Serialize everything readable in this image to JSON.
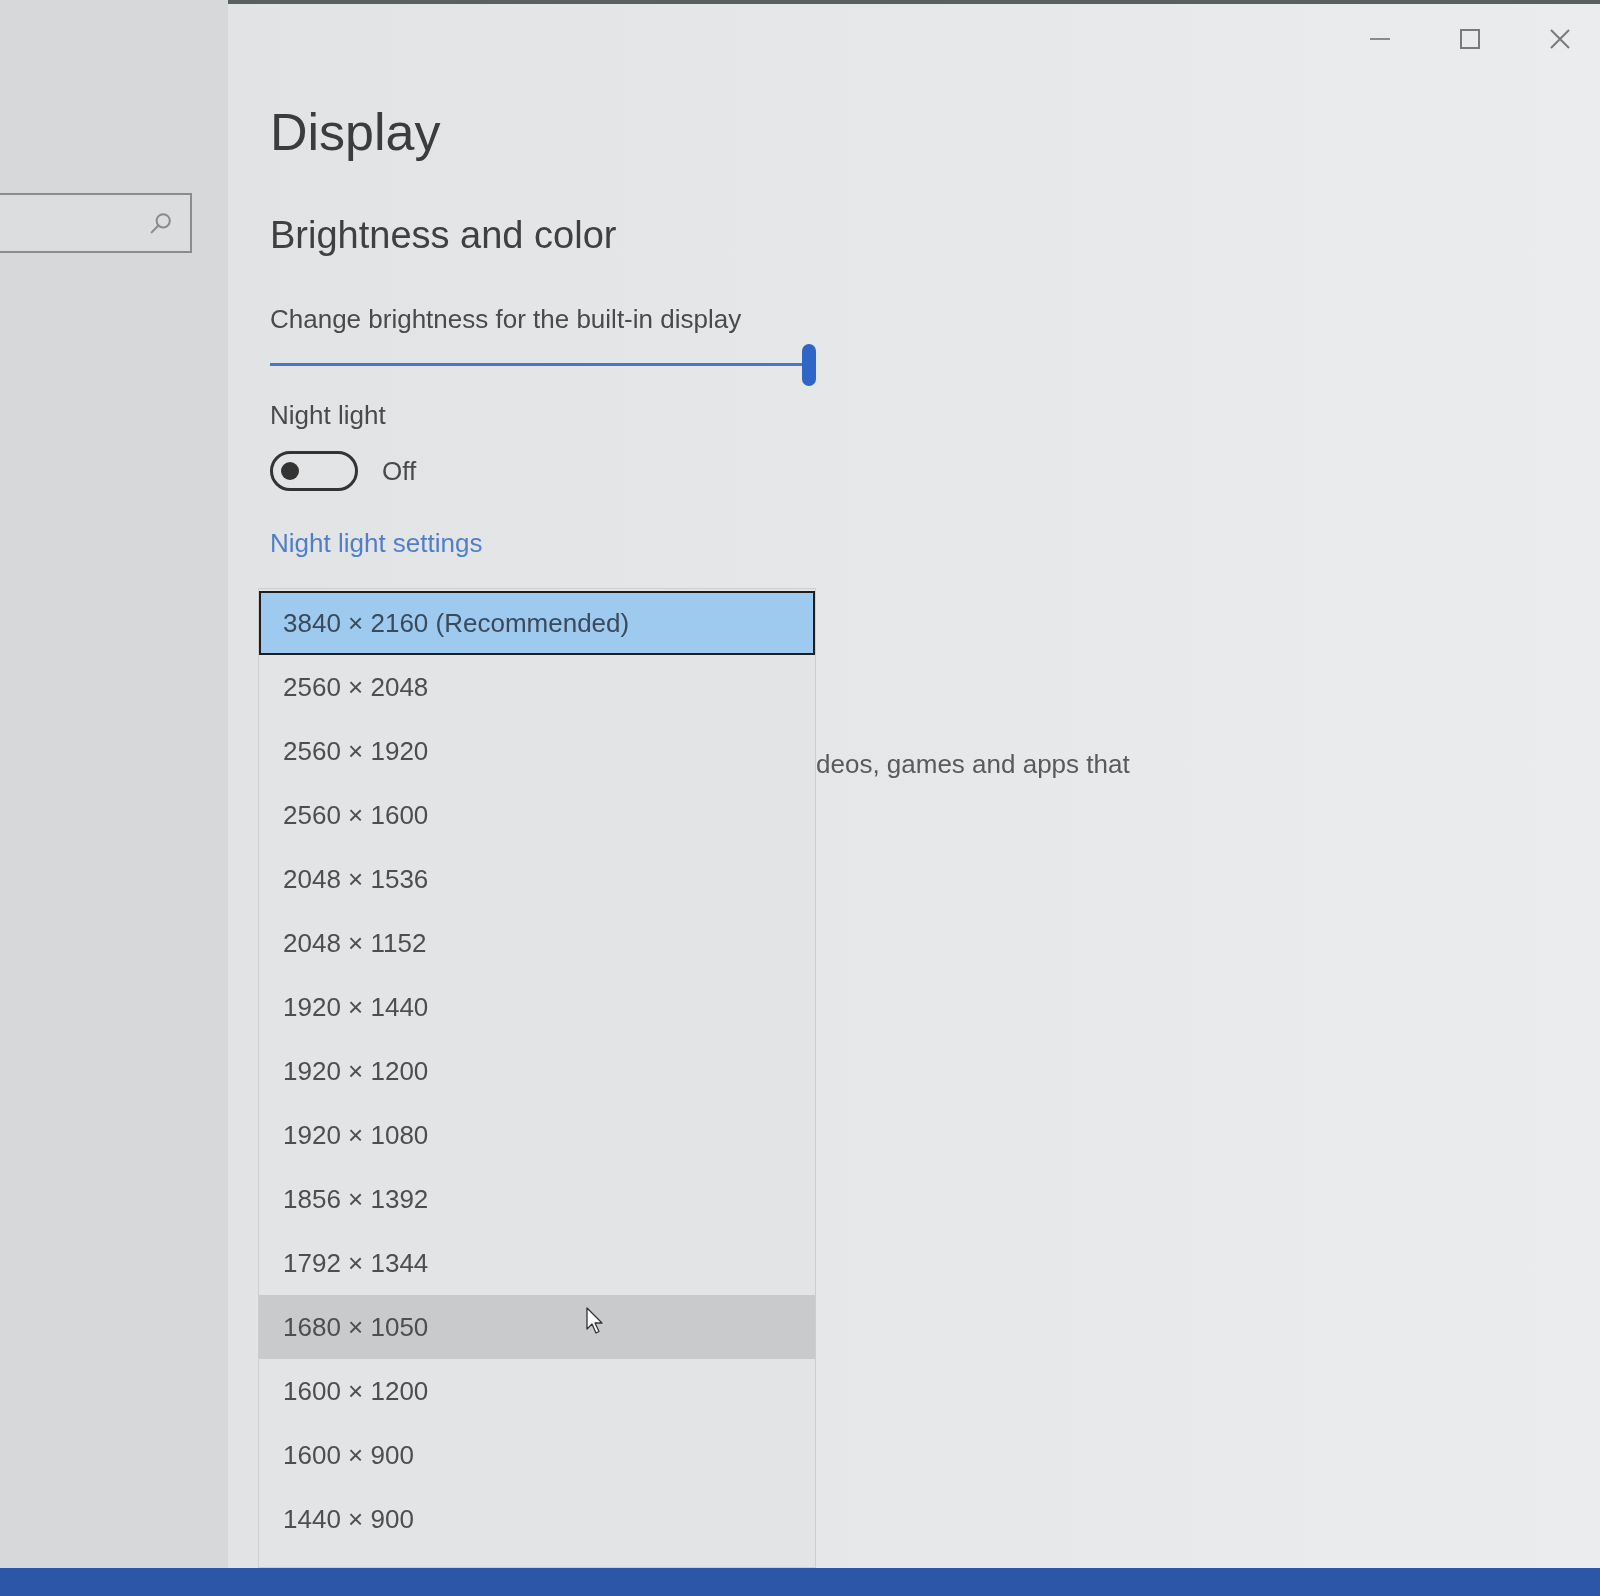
{
  "page": {
    "title": "Display"
  },
  "brightness": {
    "heading": "Brightness and color",
    "label": "Change brightness for the built-in display",
    "level": 1.0
  },
  "night_light": {
    "label": "Night light",
    "on": false,
    "state_text": "Off",
    "settings_link": "Night light settings"
  },
  "background_text": "deos, games and apps that",
  "resolution_list": {
    "items": [
      {
        "label": "3840 × 2160 (Recommended)",
        "selected": true,
        "hovered": false
      },
      {
        "label": "2560 × 2048",
        "selected": false,
        "hovered": false
      },
      {
        "label": "2560 × 1920",
        "selected": false,
        "hovered": false
      },
      {
        "label": "2560 × 1600",
        "selected": false,
        "hovered": false
      },
      {
        "label": "2048 × 1536",
        "selected": false,
        "hovered": false
      },
      {
        "label": "2048 × 1152",
        "selected": false,
        "hovered": false
      },
      {
        "label": "1920 × 1440",
        "selected": false,
        "hovered": false
      },
      {
        "label": "1920 × 1200",
        "selected": false,
        "hovered": false
      },
      {
        "label": "1920 × 1080",
        "selected": false,
        "hovered": false
      },
      {
        "label": "1856 × 1392",
        "selected": false,
        "hovered": false
      },
      {
        "label": "1792 × 1344",
        "selected": false,
        "hovered": false
      },
      {
        "label": "1680 × 1050",
        "selected": false,
        "hovered": true
      },
      {
        "label": "1600 × 1200",
        "selected": false,
        "hovered": false
      },
      {
        "label": "1600 × 900",
        "selected": false,
        "hovered": false
      },
      {
        "label": "1440 × 900",
        "selected": false,
        "hovered": false
      }
    ]
  }
}
